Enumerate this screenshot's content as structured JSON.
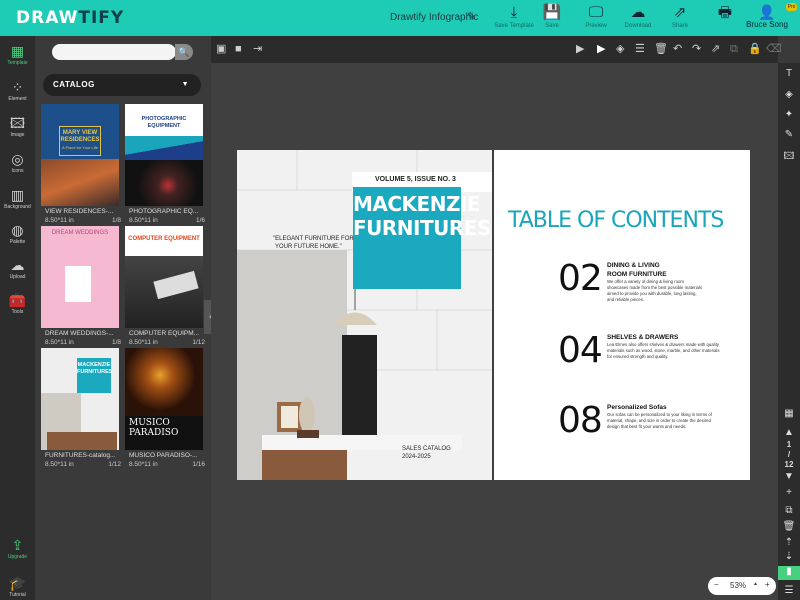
{
  "app": {
    "logo_a": "DRAW",
    "logo_b": "TIFY",
    "doc_name": "Drawtify Infographic"
  },
  "toolbar": [
    {
      "name": "download-button",
      "icon": "⤓",
      "label": "Save Template"
    },
    {
      "name": "save-button",
      "icon": "💾",
      "label": "Save"
    },
    {
      "name": "preview-button",
      "icon": "🖵",
      "label": "Preview"
    },
    {
      "name": "upload-cloud-button",
      "icon": "☁",
      "label": "Download"
    },
    {
      "name": "share-button",
      "icon": "⇗",
      "label": "Share"
    },
    {
      "name": "print-button",
      "icon": "🖶",
      "label": ""
    }
  ],
  "user": {
    "name": "Bruce Song",
    "badge": "Pro"
  },
  "leftbar": [
    {
      "name": "template",
      "label": "Template",
      "icon": "▦"
    },
    {
      "name": "element",
      "label": "Element",
      "icon": "⁘"
    },
    {
      "name": "image",
      "label": "Image",
      "icon": "🖾"
    },
    {
      "name": "icons",
      "label": "Icons",
      "icon": "◎"
    },
    {
      "name": "background",
      "label": "Background",
      "icon": "▥"
    },
    {
      "name": "palette",
      "label": "Palette",
      "icon": "◍"
    },
    {
      "name": "upload",
      "label": "Upload",
      "icon": "☁"
    },
    {
      "name": "tools",
      "label": "Tools",
      "icon": "🧰"
    },
    {
      "name": "upgrade",
      "label": "Upgrade",
      "icon": "⇪"
    },
    {
      "name": "tutorial",
      "label": "Tutorial",
      "icon": "🎓"
    }
  ],
  "panel": {
    "search_placeholder": "",
    "category": "CATALOG"
  },
  "templates": [
    {
      "name": "VIEW RESIDENCES-...",
      "size": "8.50*11 in",
      "pages": "1/8",
      "t1": "MARY VIEW",
      "t2": "RESIDENCES",
      "t3": "A Place for Your Life"
    },
    {
      "name": "PHOTOGRAPHIC EQ...",
      "size": "8.50*11 in",
      "pages": "1/6",
      "t1": "PHOTOGRAPHIC",
      "t2": "EQUIPMENT",
      "t3": ""
    },
    {
      "name": "DREAM WEDDINGS-...",
      "size": "8.50*11 in",
      "pages": "1/8",
      "t1": "DREAM WEDDINGS",
      "t2": "",
      "t3": ""
    },
    {
      "name": "COMPUTER EQUIPM...",
      "size": "8.50*11 in",
      "pages": "1/12",
      "t1": "COMPUTER EQUIPMENT",
      "t2": "",
      "t3": ""
    },
    {
      "name": "FURNITURES-catalog...",
      "size": "8.50*11 in",
      "pages": "1/12",
      "t1": "MACKENZIE",
      "t2": "FURNITURES",
      "t3": ""
    },
    {
      "name": "MUSICO PARADISO-...",
      "size": "8.50*11 in",
      "pages": "1/16",
      "t1": "MUSICO",
      "t2": "PARADISO",
      "t3": ""
    }
  ],
  "doc": {
    "issue": "VOLUME 5, ISSUE NO. 3",
    "title1": "MACKENZIE",
    "title2": "FURNITURES",
    "quote1": "\"ELEGANT FURNITURE FOR",
    "quote2": "YOUR FUTURE HOME.\"",
    "sales1": "SALES CATALOG",
    "sales2": "2024-2025",
    "toc_title": "TABLE OF CONTENTS",
    "toc": [
      {
        "num": "02",
        "head1": "DINING & LIVING",
        "head2": "ROOM FURNITURE",
        "body": [
          "We offer a variety of dining & living room",
          "showcases made from the best possible materials",
          "aimed to provide you with durable, long lasting,",
          " and reliable pieces."
        ]
      },
      {
        "num": "04",
        "head1": "SHELVES & DRAWERS",
        "head2": "",
        "body": [
          "Lea Elmes also offers shelves & drawers made with quality",
          "materials such as wood, stone, marble, and other materials",
          "for ensured strength and quality."
        ]
      },
      {
        "num": "08",
        "head1": "Personalized Sofas",
        "head2": "",
        "body": [
          "Our sofas can be personalized to your liking in terms of",
          "material, shape, and size in order to create the desired",
          "design that best fit your wants and needs."
        ]
      }
    ]
  },
  "pager": {
    "current": "1",
    "sep": "/",
    "total": "12"
  },
  "zoom": {
    "minus": "−",
    "value": "53%",
    "plus": "+"
  },
  "colors": {
    "brand": "#1ecbb5",
    "teal": "#1aa5bc",
    "upgrade": "#47d07e"
  }
}
